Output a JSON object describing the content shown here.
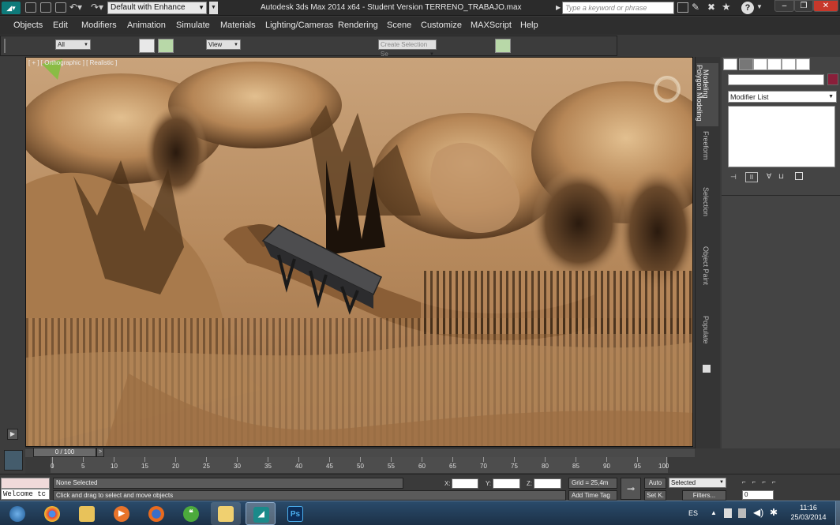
{
  "titlebar": {
    "workspace": "Default with Enhance",
    "app_title": "Autodesk 3ds Max  2014 x64  - Student Version   TERRENO_TRABAJO.max",
    "search_placeholder": "Type a keyword or phrase",
    "help_icon": "?"
  },
  "menu": {
    "items": [
      "Objects",
      "Edit",
      "Modifiers",
      "Animation",
      "Simulate",
      "Materials",
      "Lighting/Cameras",
      "Rendering",
      "Scene",
      "Customize",
      "MAXScript",
      "Help"
    ]
  },
  "toolbar": {
    "filter": "All",
    "refcoord": "View",
    "selset": "Create Selection Se"
  },
  "viewport": {
    "label": "[ + ] [ Orthographic ] [ Realistic ]"
  },
  "ribbon": {
    "tabs": [
      "Modeling",
      "Polygon Modeling",
      "Freeform",
      "Selection",
      "Object Paint",
      "Populate"
    ]
  },
  "command_panel": {
    "modifier_list": "Modifier List"
  },
  "timeline": {
    "frame_display": "0 / 100",
    "ticks": [
      "0",
      "5",
      "10",
      "15",
      "20",
      "25",
      "30",
      "35",
      "40",
      "45",
      "50",
      "55",
      "60",
      "65",
      "70",
      "75",
      "80",
      "85",
      "90",
      "95",
      "100"
    ]
  },
  "status": {
    "maxscript": "Welcome tc",
    "selection": "None Selected",
    "prompt": "Click and drag to select and move objects",
    "x_label": "X:",
    "y_label": "Y:",
    "z_label": "Z:",
    "grid": "Grid = 25,4m",
    "add_time_tag": "Add Time Tag",
    "auto": "Auto",
    "set_key": "Set K.",
    "selected": "Selected",
    "filters": "Filters...",
    "frame": "0"
  },
  "taskbar": {
    "lang": "ES",
    "time": "11:16",
    "date": "25/03/2014"
  },
  "colors": {
    "accent_green": "#b8d8a8",
    "swatch": "#8a1f3a"
  }
}
